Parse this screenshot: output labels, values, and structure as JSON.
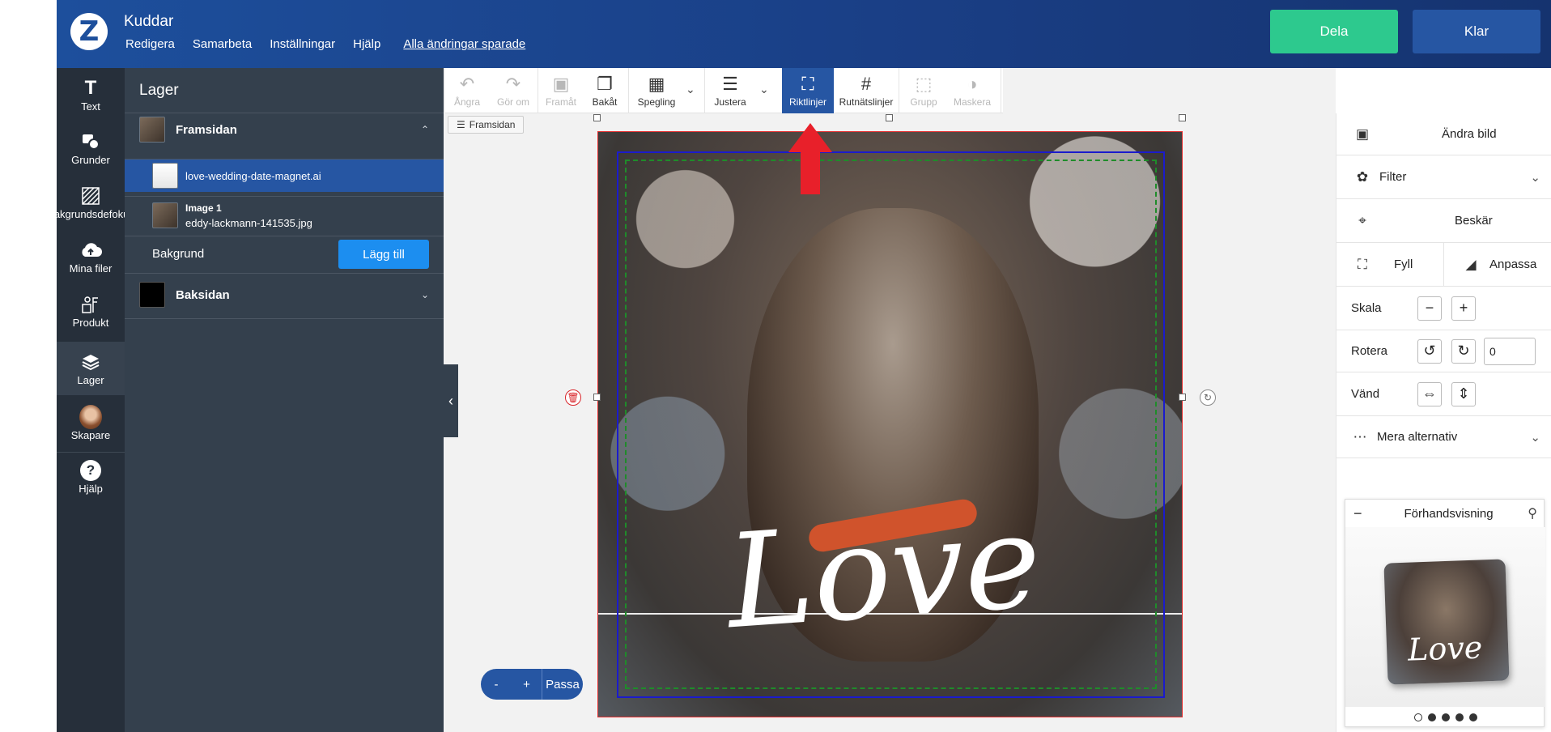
{
  "header": {
    "app_title": "Kuddar",
    "logo_glyph": "Z",
    "menu": [
      "Redigera",
      "Samarbeta",
      "Inställningar",
      "Hjälp"
    ],
    "saved_status": "Alla ändringar sparade",
    "share_label": "Dela",
    "done_label": "Klar",
    "colors": {
      "share": "#2dc98e",
      "done": "#2656a3",
      "header": "#1d4f9c"
    }
  },
  "iconbar": {
    "items": [
      {
        "label": "Text",
        "icon": "text-icon"
      },
      {
        "label": "Grunder",
        "icon": "shapes-icon"
      },
      {
        "label": "Bakgrundsdefokus",
        "icon": "pattern-icon"
      },
      {
        "label": "Mina filer",
        "icon": "cloud-upload-icon"
      },
      {
        "label": "Produkt",
        "icon": "product-icon"
      },
      {
        "label": "Lager",
        "icon": "layers-icon"
      },
      {
        "label": "Skapare",
        "icon": "avatar-icon"
      },
      {
        "label": "Hjälp",
        "icon": "help-icon"
      }
    ],
    "active": "Lager"
  },
  "layers_panel": {
    "title": "Lager",
    "front": {
      "label": "Framsidan"
    },
    "layer_items": [
      {
        "name": "love-wedding-date-magnet.ai",
        "sub": ""
      },
      {
        "name": "Image 1",
        "sub": "eddy-lackmann-141535.jpg"
      }
    ],
    "background": {
      "label": "Bakgrund",
      "add_label": "Lägg till"
    },
    "back": {
      "label": "Baksidan"
    }
  },
  "toolbar": {
    "undo": "Ångra",
    "redo": "Gör om",
    "forward": "Framåt",
    "backward": "Bakåt",
    "mirror": "Spegling",
    "align": "Justera",
    "guides": "Riktlinjer",
    "gridlines": "Rutnätslinjer",
    "group": "Grupp",
    "mask": "Maskera"
  },
  "canvas": {
    "side_chip": "Framsidan",
    "design_text": "Love"
  },
  "zoom": {
    "minus": "-",
    "plus": "+",
    "fit": "Passa"
  },
  "right_panel": {
    "change_image": "Ändra bild",
    "filter": "Filter",
    "crop": "Beskär",
    "fill": "Fyll",
    "fit": "Anpassa",
    "scale": "Skala",
    "rotate": "Rotera",
    "rotate_value": "0",
    "flip": "Vänd",
    "more": "Mera alternativ"
  },
  "preview": {
    "title": "Förhandsvisning",
    "pillow_text": "Love",
    "pages": 5,
    "current_page": 1
  }
}
